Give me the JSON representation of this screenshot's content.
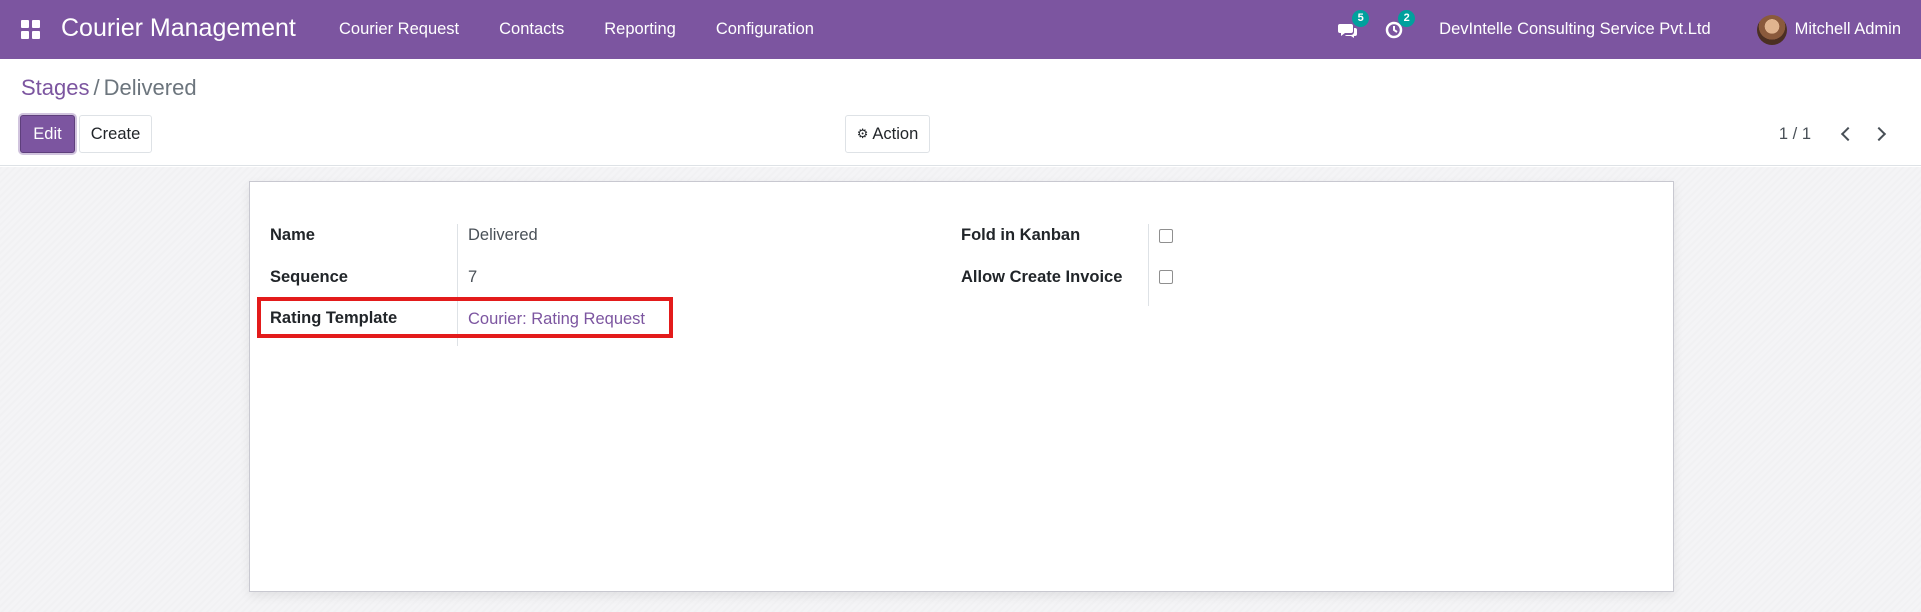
{
  "navbar": {
    "brand": "Courier Management",
    "menu": [
      "Courier Request",
      "Contacts",
      "Reporting",
      "Configuration"
    ],
    "messages_badge": "5",
    "activities_badge": "2",
    "company": "DevIntelle Consulting Service Pvt.Ltd",
    "user": "Mitchell Admin"
  },
  "breadcrumb": {
    "parent": "Stages",
    "separator": "/",
    "current": "Delivered"
  },
  "buttons": {
    "edit": "Edit",
    "create": "Create",
    "action": "Action"
  },
  "pager": {
    "value": "1 / 1"
  },
  "form": {
    "left": [
      {
        "label": "Name",
        "value": "Delivered"
      },
      {
        "label": "Sequence",
        "value": "7"
      },
      {
        "label": "Rating Template",
        "value": "Courier: Rating Request"
      }
    ],
    "right": [
      {
        "label": "Fold in Kanban",
        "checked": false
      },
      {
        "label": "Allow Create Invoice",
        "checked": false
      }
    ]
  },
  "colors": {
    "brand": "#7c55a0",
    "badge": "#00a09d",
    "highlight": "#e31b1b"
  }
}
